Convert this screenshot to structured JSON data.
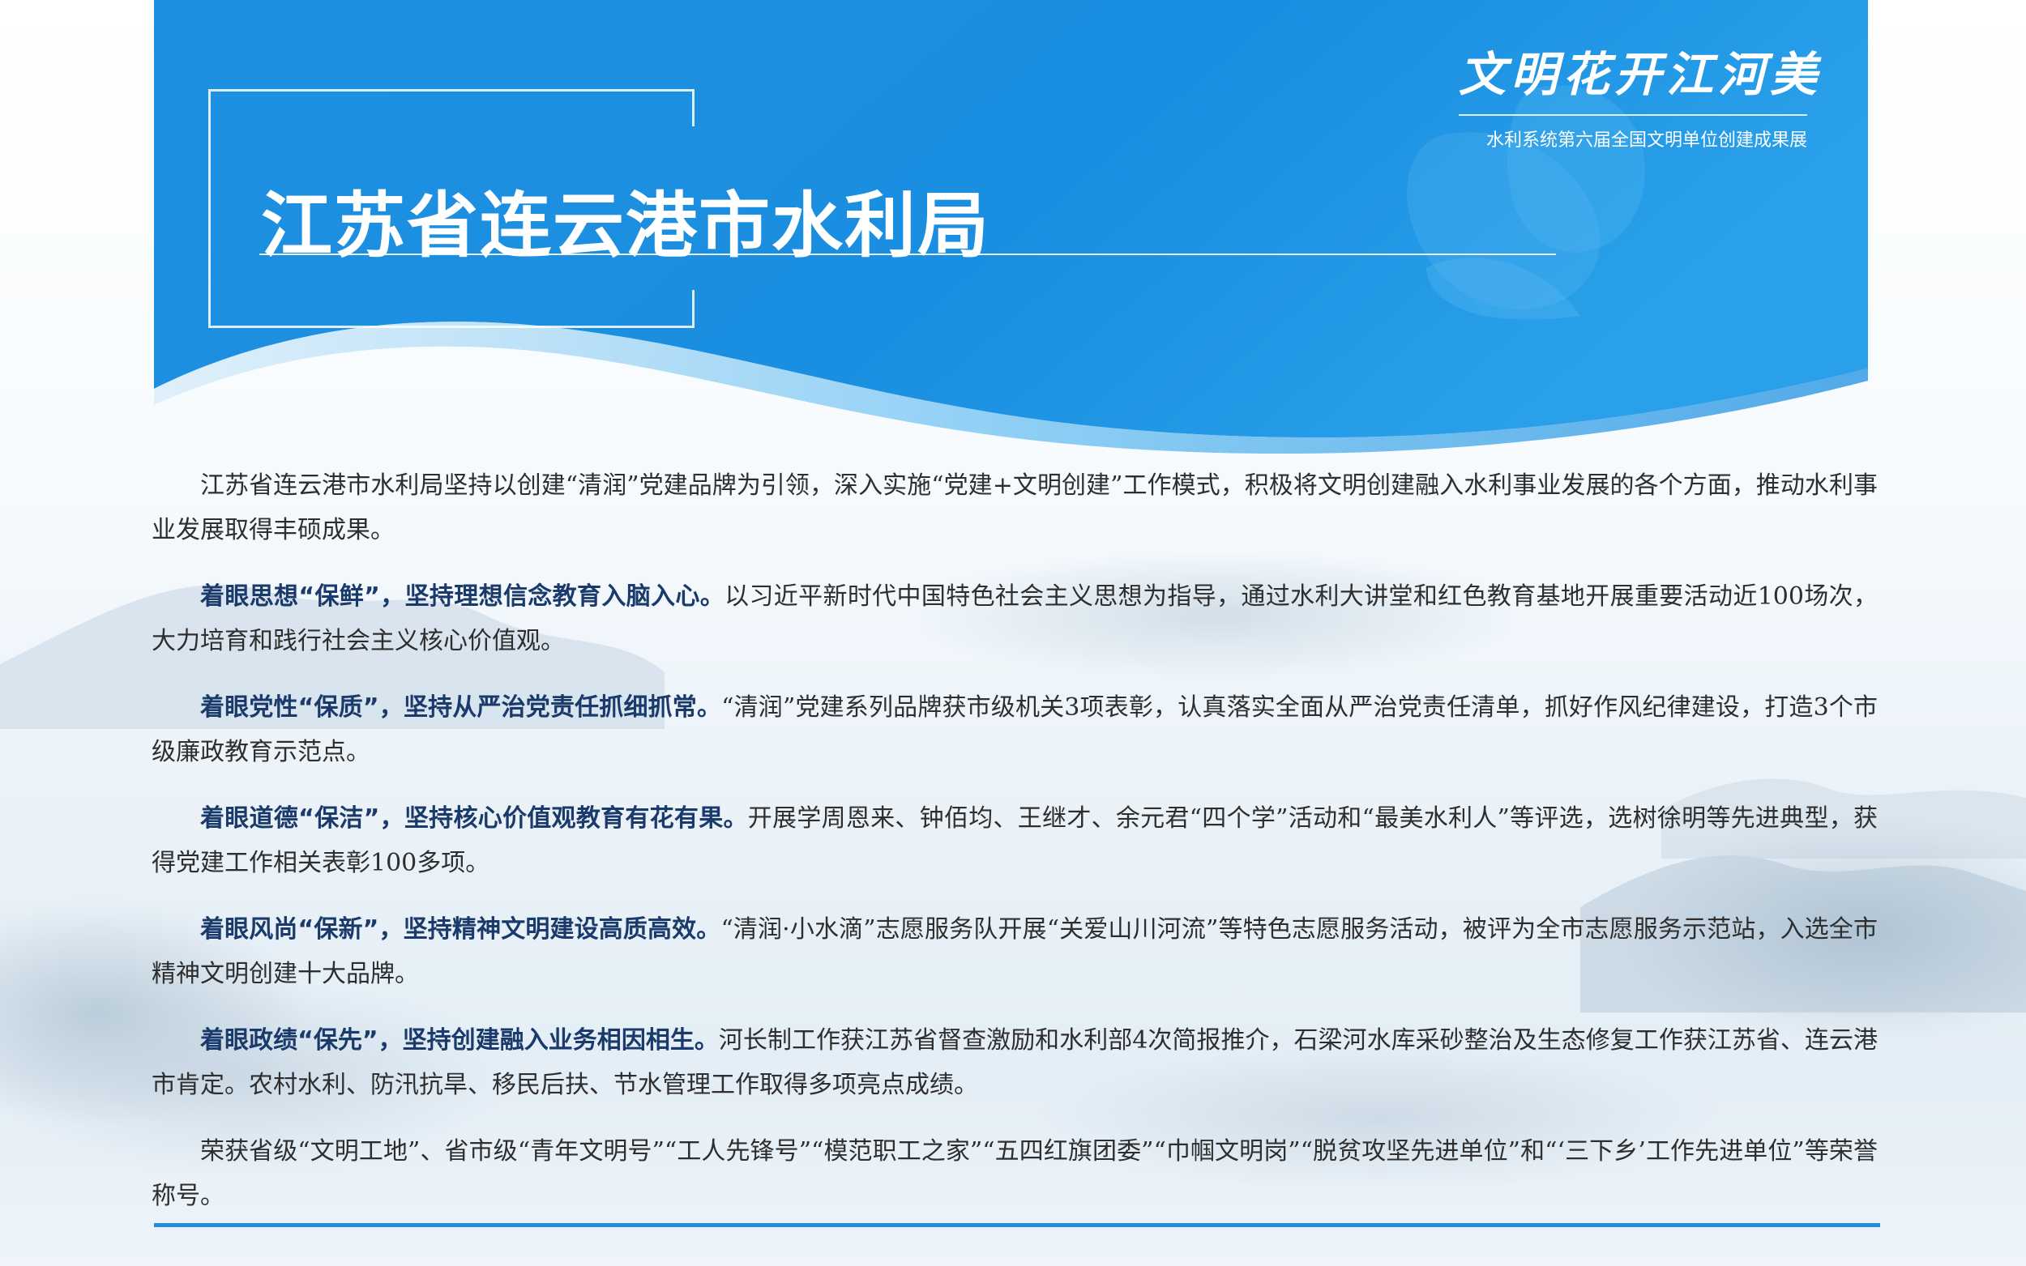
{
  "header": {
    "title": "江苏省连云港市水利局",
    "brand_calligraphy": "文明花开江河美",
    "brand_subtitle": "水利系统第六届全国文明单位创建成果展"
  },
  "colors": {
    "header_blue": "#1a8fe0",
    "header_blue_light": "#5cb8f0",
    "lead_text": "#1a3a6b",
    "body_text": "#2e2e2e",
    "rule": "#1e8fd8"
  },
  "paragraphs": [
    {
      "lead": "",
      "text": "江苏省连云港市水利局坚持以创建“清润”党建品牌为引领，深入实施“党建+文明创建”工作模式，积极将文明创建融入水利事业发展的各个方面，推动水利事业发展取得丰硕成果。"
    },
    {
      "lead": "着眼思想“保鲜”，坚持理想信念教育入脑入心。",
      "text": "以习近平新时代中国特色社会主义思想为指导，通过水利大讲堂和红色教育基地开展重要活动近100场次，大力培育和践行社会主义核心价值观。"
    },
    {
      "lead": "着眼党性“保质”，坚持从严治党责任抓细抓常。",
      "text": "“清润”党建系列品牌获市级机关3项表彰，认真落实全面从严治党责任清单，抓好作风纪律建设，打造3个市级廉政教育示范点。"
    },
    {
      "lead": "着眼道德“保洁”，坚持核心价值观教育有花有果。",
      "text": "开展学周恩来、钟佰均、王继才、余元君“四个学”活动和“最美水利人”等评选，选树徐明等先进典型，获得党建工作相关表彰100多项。"
    },
    {
      "lead": "着眼风尚“保新”，坚持精神文明建设高质高效。",
      "text": "“清润·小水滴”志愿服务队开展“关爱山川河流”等特色志愿服务活动，被评为全市志愿服务示范站，入选全市精神文明创建十大品牌。"
    },
    {
      "lead": "着眼政绩“保先”，坚持创建融入业务相因相生。",
      "text": "河长制工作获江苏省督查激励和水利部4次简报推介，石梁河水库采砂整治及生态修复工作获江苏省、连云港市肯定。农村水利、防汛抗旱、移民后扶、节水管理工作取得多项亮点成绩。"
    },
    {
      "lead": "",
      "text": "荣获省级“文明工地”、省市级“青年文明号”“工人先锋号”“模范职工之家”“五四红旗团委”“巾帼文明岗”“脱贫攻坚先进单位”和“‘三下乡’工作先进单位”等荣誉称号。"
    }
  ]
}
